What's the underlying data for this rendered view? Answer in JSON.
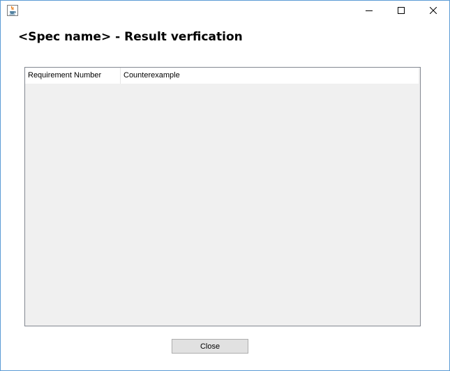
{
  "window": {
    "title": "",
    "icon": "java-coffee-cup-icon",
    "controls": [
      "minimize-icon",
      "maximize-icon",
      "close-icon"
    ]
  },
  "header": {
    "title": "<Spec name> - Result verfication"
  },
  "table": {
    "columns": [
      "Requirement Number",
      "Counterexample"
    ],
    "rows": []
  },
  "footer": {
    "close_label": "Close"
  },
  "colors": {
    "window_border": "#5b9bd5",
    "panel_background": "#f0f0f0",
    "button_background": "#e1e1e1"
  }
}
